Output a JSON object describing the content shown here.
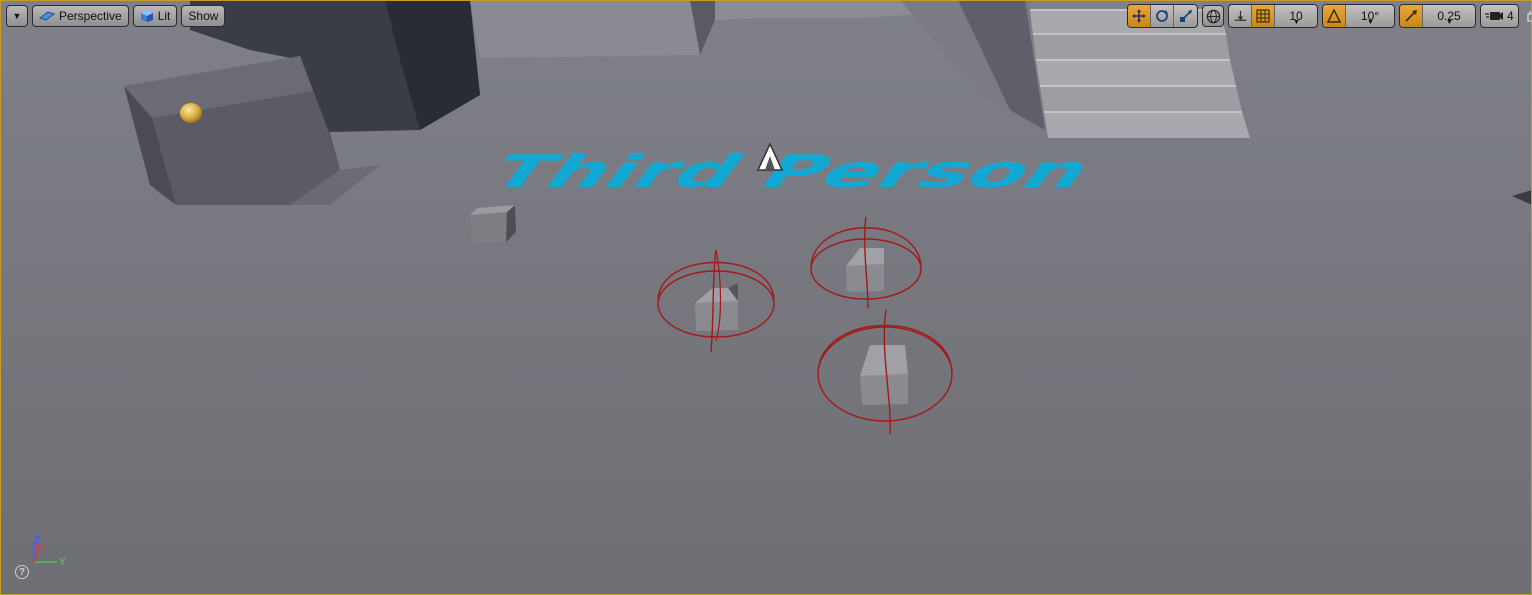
{
  "toolbar_left": {
    "menu_icon": "chevron-down-icon",
    "perspective_label": "Perspective",
    "lit_label": "Lit",
    "show_label": "Show"
  },
  "toolbar_right": {
    "grid_snap_value": "10",
    "rotation_snap_value": "10°",
    "scale_snap_value": "0.25",
    "camera_speed_value": "4"
  },
  "scene": {
    "floor_text": "Third Person"
  },
  "axis_widget": {
    "z_label": "Z",
    "x_label": "X",
    "y_label": "Y",
    "help_label": "?"
  },
  "colors": {
    "active_orange": "#d8961f",
    "floor_text_blue": "#12a8d4",
    "gizmo_red": "#a41818",
    "viewport_border": "#c89b25"
  }
}
